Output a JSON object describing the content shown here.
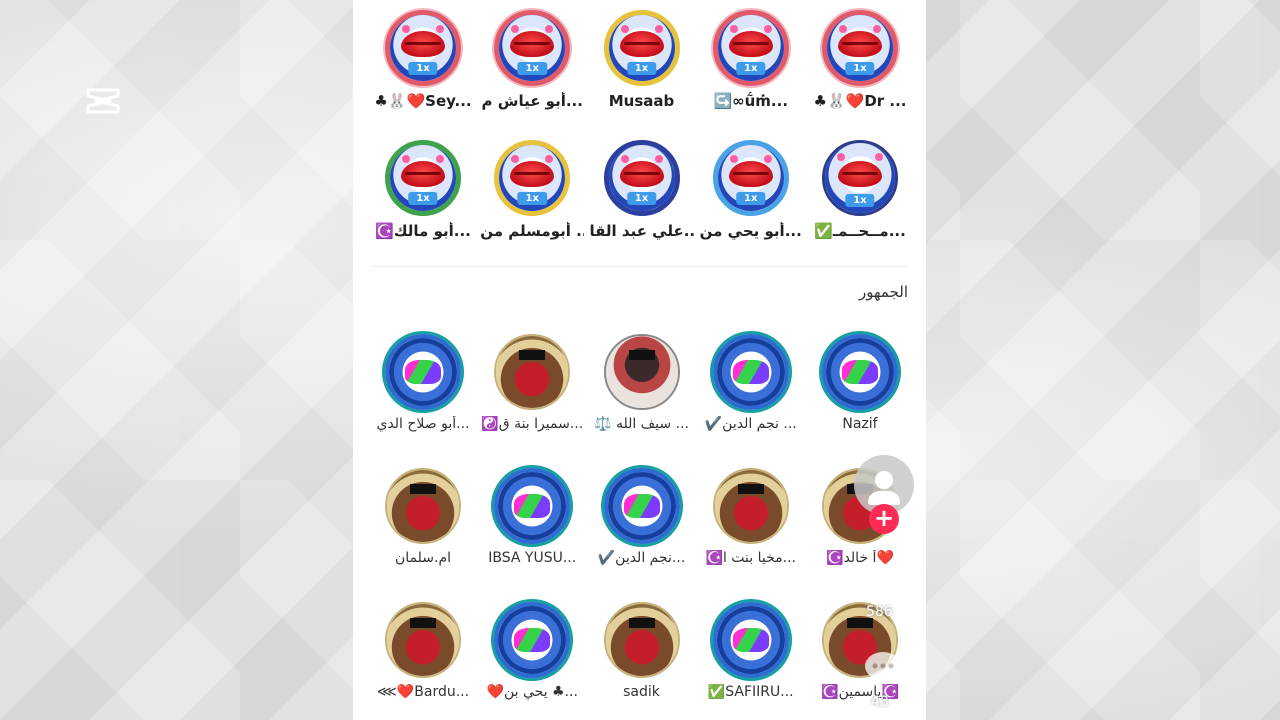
{
  "gifters": {
    "row1": [
      {
        "name": "♣︎🐰❤️Dr ...",
        "ring": "red",
        "badge": "1x"
      },
      {
        "name": "↪️∞ṹṁ...",
        "ring": "red",
        "badge": "1x"
      },
      {
        "name": "Musaab",
        "ring": "gold",
        "badge": "1x"
      },
      {
        "name": "أبو عياش م...",
        "ring": "red",
        "badge": "1x"
      },
      {
        "name": "♣︎🐰❤️Sey...",
        "ring": "red",
        "badge": "1x"
      }
    ],
    "row2": [
      {
        "name": "✅مــحــمـ...",
        "ring": "dark",
        "badge": "1x"
      },
      {
        "name": "أبو يحي من...",
        "ring": "sky",
        "badge": "1x"
      },
      {
        "name": "علي عبد القا...",
        "ring": "navy",
        "badge": "1x"
      },
      {
        "name": "أبومسلم من ...",
        "ring": "gold",
        "badge": "1x"
      },
      {
        "name": "☪️أبو مالك...",
        "ring": "green",
        "badge": "1x"
      }
    ]
  },
  "audience": {
    "title": "الجمهور",
    "row1": [
      {
        "name": "Nazif",
        "type": "logo"
      },
      {
        "name": "✔️نجم الدين ...",
        "type": "logo"
      },
      {
        "name": "⚖️ سيف الله ...",
        "type": "photo"
      },
      {
        "name": "☯️سميرا بنة ق...",
        "type": "grad"
      },
      {
        "name": "أبو صلاح الدي...",
        "type": "logo"
      }
    ],
    "row2": [
      {
        "name": "☪️أ خالد❤️",
        "type": "grad"
      },
      {
        "name": "☪️مخيا بنت ا...",
        "type": "grad"
      },
      {
        "name": "✔️نجم الدين...",
        "type": "logo"
      },
      {
        "name": "IBSA YUSU...",
        "type": "logo"
      },
      {
        "name": "ام.سلمان",
        "type": "grad"
      }
    ],
    "row3": [
      {
        "name": "☪️ياسمين☪️",
        "type": "grad"
      },
      {
        "name": "✅SAFIIRU...",
        "type": "logo"
      },
      {
        "name": "sadik",
        "type": "grad"
      },
      {
        "name": "❤️يحي بن ♣︎...",
        "type": "logo"
      },
      {
        "name": "⋘❤️Bardu...",
        "type": "grad"
      }
    ]
  },
  "side_actions": {
    "like_count": "586",
    "comment_count": "43",
    "plus_label": "+",
    "icons": [
      "profile-icon",
      "plus-icon",
      "heart-icon",
      "comment-icon"
    ]
  },
  "colors": {
    "accent": "#fe2c55",
    "badge": "#3d9be9"
  }
}
